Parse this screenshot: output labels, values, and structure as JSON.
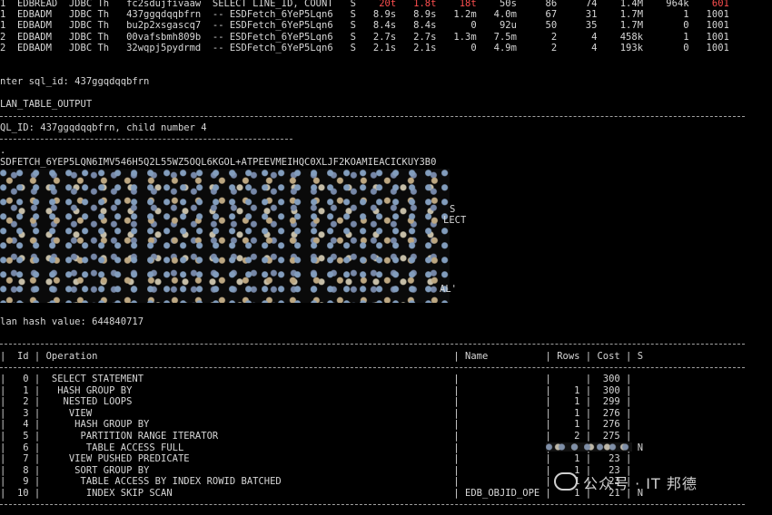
{
  "session_rows": [
    {
      "c0": "1",
      "c1": "EDBREAD",
      "c2": "JDBC Th",
      "c3": "fc2sdujfivaaw",
      "c4": "SELECT LINE_ID, COUNT",
      "c5": "S",
      "c6": "20t",
      "c7": "1.8t",
      "c8": "18t",
      "c9": "50s",
      "c10": "86",
      "c11": "74",
      "c12": "1.4M",
      "c13": "964k",
      "c14": "601"
    },
    {
      "c0": "1",
      "c1": "EDBADM",
      "c2": "JDBC Th",
      "c3": "437ggqdqqbfrn",
      "c4": "-- ESDFetch_6YeP5Lqn6",
      "c5": "S",
      "c6": "8.9s",
      "c7": "8.9s",
      "c8": "1.2m",
      "c9": "4.0m",
      "c10": "67",
      "c11": "31",
      "c12": "1.7M",
      "c13": "1",
      "c14": "1001"
    },
    {
      "c0": "1",
      "c1": "EDBADM",
      "c2": "JDBC Th",
      "c3": "bu2p2xsgascq7",
      "c4": "-- ESDFetch_6YeP5Lqn6",
      "c5": "S",
      "c6": "8.4s",
      "c7": "8.4s",
      "c8": "0",
      "c9": "92u",
      "c10": "50",
      "c11": "35",
      "c12": "1.7M",
      "c13": "0",
      "c14": "1001"
    },
    {
      "c0": "2",
      "c1": "EDBADM",
      "c2": "JDBC Th",
      "c3": "00vafsbmh809b",
      "c4": "-- ESDFetch_6YeP5Lqn6",
      "c5": "S",
      "c6": "2.7s",
      "c7": "2.7s",
      "c8": "1.3m",
      "c9": "7.5m",
      "c10": "2",
      "c11": "4",
      "c12": "458k",
      "c13": "1",
      "c14": "1001"
    },
    {
      "c0": "2",
      "c1": "EDBADM",
      "c2": "JDBC Th",
      "c3": "32wqpj5pydrmd",
      "c4": "-- ESDFetch_6YeP5Lqn6",
      "c5": "S",
      "c6": "2.1s",
      "c7": "2.1s",
      "c8": "0",
      "c9": "4.9m",
      "c10": "2",
      "c11": "4",
      "c12": "193k",
      "c13": "0",
      "c14": "1001"
    }
  ],
  "prompt_sql_id": "nter sql_id: 437ggqdqqbfrn",
  "plan_table_output": "LAN_TABLE_OUTPUT",
  "sql_id_line": "QL_ID: 437ggqdqqbfrn, child number 4",
  "esdfetch_line": "SDFETCH_6YEP5LQN6IMV546H5Q2L55WZ5OQL6KGOL+ATPEEVMEIHQC0XLJF2KOAMIEACICKUY3B0",
  "right_frag_1": "S",
  "right_frag_2": "LECT",
  "right_frag_3": "AL'",
  "plan_hash_line": "lan hash value: 644840717",
  "table_header": {
    "id": "Id",
    "operation": "Operation",
    "name": "Name",
    "rows": "Rows",
    "cost": "Cost",
    "s": "S"
  },
  "plan_rows": [
    {
      "id": "0",
      "op": "SELECT STATEMENT",
      "name": "",
      "rows": "",
      "cost": "300",
      "s": ""
    },
    {
      "id": "1",
      "op": " HASH GROUP BY",
      "name": "",
      "rows": "1",
      "cost": "300",
      "s": ""
    },
    {
      "id": "2",
      "op": "  NESTED LOOPS",
      "name": "",
      "rows": "1",
      "cost": "299",
      "s": ""
    },
    {
      "id": "3",
      "op": "   VIEW",
      "name": "",
      "rows": "1",
      "cost": "276",
      "s": ""
    },
    {
      "id": "4",
      "op": "    HASH GROUP BY",
      "name": "",
      "rows": "1",
      "cost": "276",
      "s": ""
    },
    {
      "id": "5",
      "op": "     PARTITION RANGE ITERATOR",
      "name": "",
      "rows": "2",
      "cost": "275",
      "s": ""
    },
    {
      "id": "6",
      "op": "      TABLE ACCESS FULL",
      "name": "",
      "rows": "2",
      "cost": "275",
      "s": "N"
    },
    {
      "id": "7",
      "op": "   VIEW PUSHED PREDICATE",
      "name": "",
      "rows": "1",
      "cost": "23",
      "s": ""
    },
    {
      "id": "8",
      "op": "    SORT GROUP BY",
      "name": "",
      "rows": "1",
      "cost": "23",
      "s": ""
    },
    {
      "id": "9",
      "op": "     TABLE ACCESS BY INDEX ROWID BATCHED",
      "name": "",
      "rows": "1",
      "cost": "23",
      "s": ""
    },
    {
      "id": "10",
      "op": "      INDEX SKIP SCAN",
      "name": "EDB_OBJID_OPER",
      "rows": "1",
      "cost": "21",
      "s": "N"
    }
  ],
  "watermark": "公众号 · IT 邦德"
}
